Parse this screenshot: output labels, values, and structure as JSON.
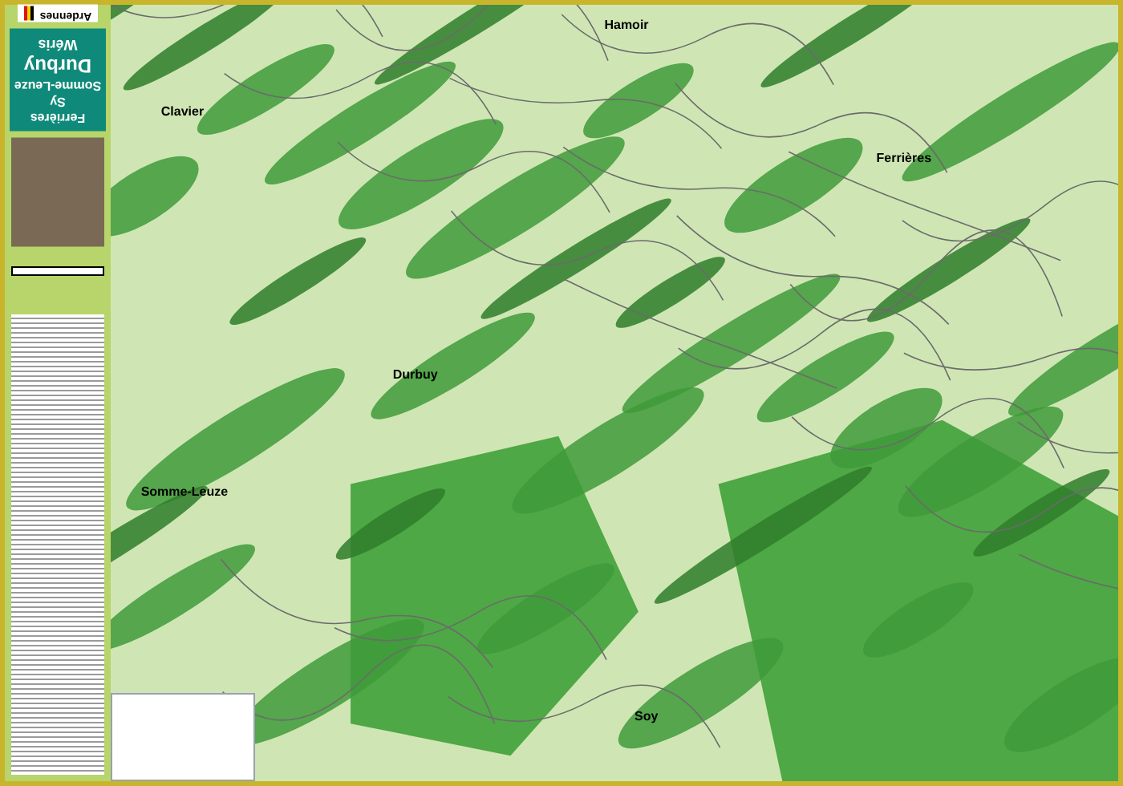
{
  "cover": {
    "region": "Ardennes",
    "title": [
      "Durbuy",
      "Wéris"
    ],
    "subtitle": [
      "Ferrières",
      "Sy",
      "Somme-Leuze"
    ]
  },
  "map": {
    "places": [
      "Hamoir",
      "Clavier",
      "Ferrières",
      "Durbuy",
      "Somme-Leuze",
      "Soy"
    ]
  }
}
